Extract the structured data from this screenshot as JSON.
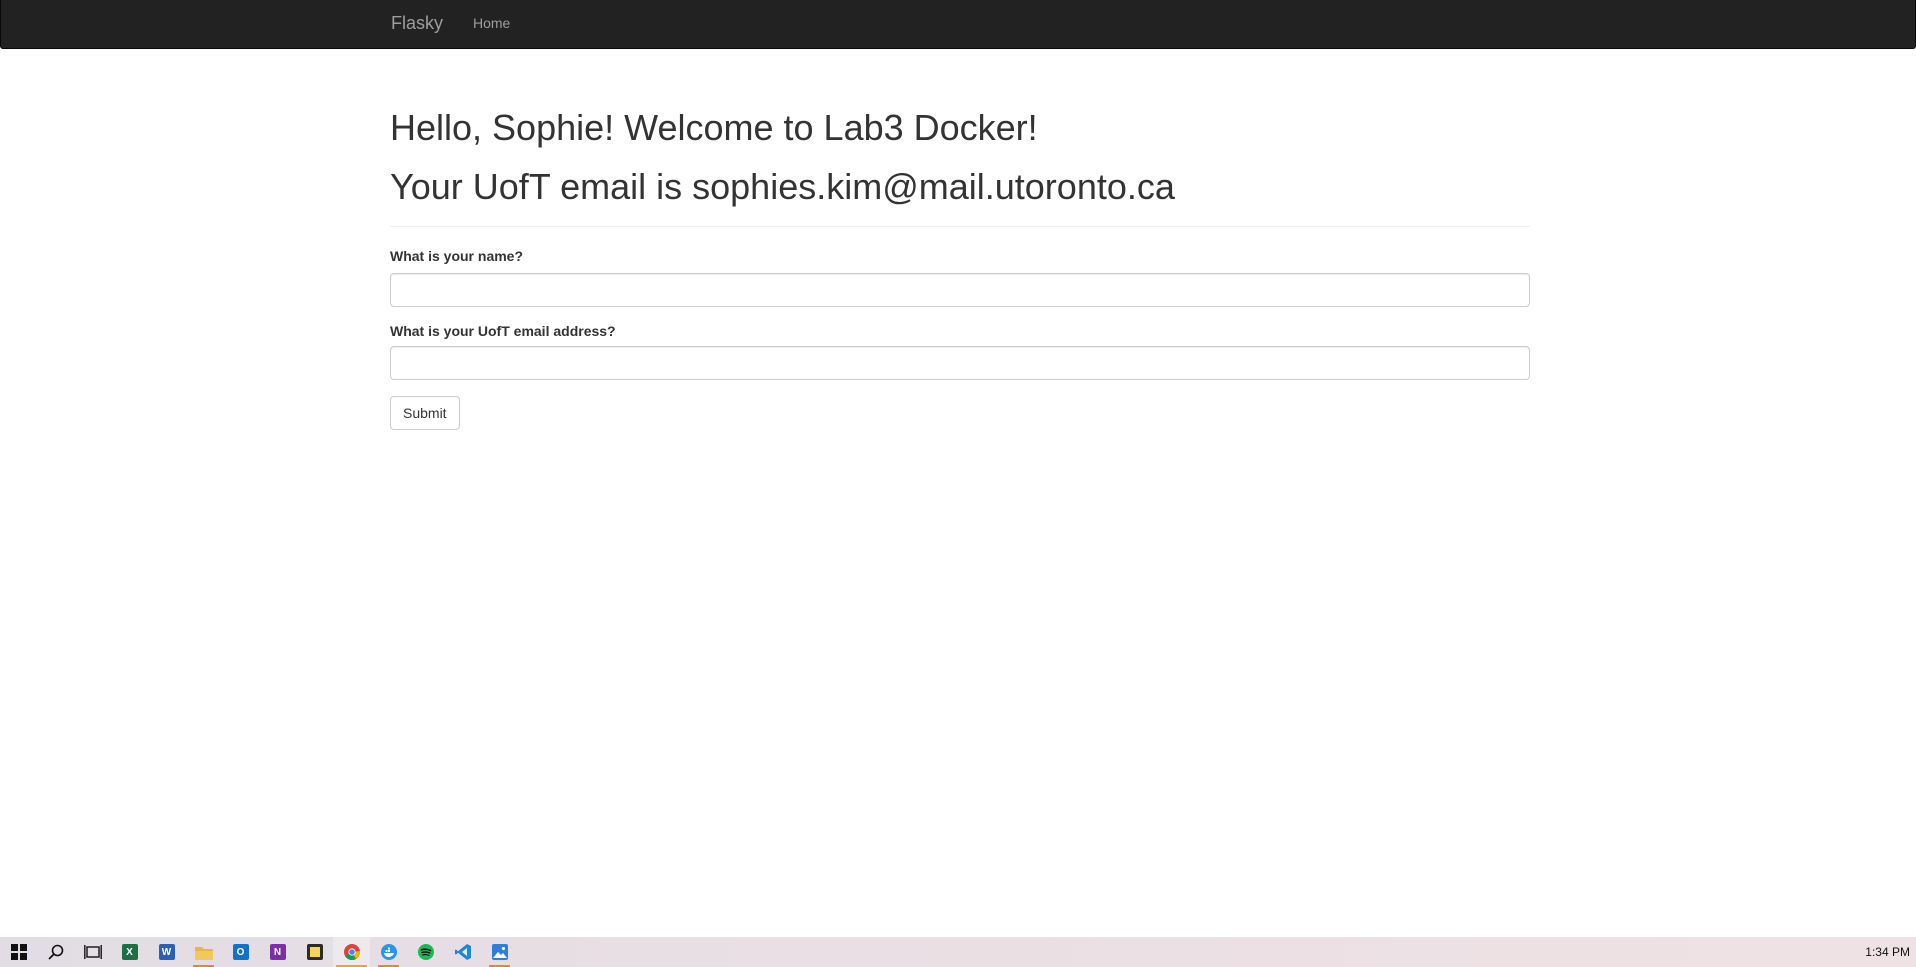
{
  "navbar": {
    "brand": "Flasky",
    "links": [
      {
        "label": "Home"
      }
    ]
  },
  "main": {
    "greeting": "Hello, Sophie! Welcome to Lab3 Docker!",
    "email_line": "Your UofT email is sophies.kim@mail.utoronto.ca",
    "form": {
      "name_label": "What is your name?",
      "name_value": "",
      "email_label": "What is your UofT email address?",
      "email_value": "",
      "submit_label": "Submit"
    }
  },
  "taskbar": {
    "icons": [
      "windows-start",
      "search",
      "task-view",
      "excel",
      "word",
      "file-explorer",
      "outlook",
      "onenote",
      "sticky-notes",
      "chrome",
      "docker",
      "spotify",
      "vscode",
      "photos"
    ],
    "active_icon": "chrome",
    "clock": "1:34 PM",
    "colors": {
      "accent": "#e8a33c",
      "navbar": "#222222",
      "nav_text": "#9d9d9d"
    }
  }
}
